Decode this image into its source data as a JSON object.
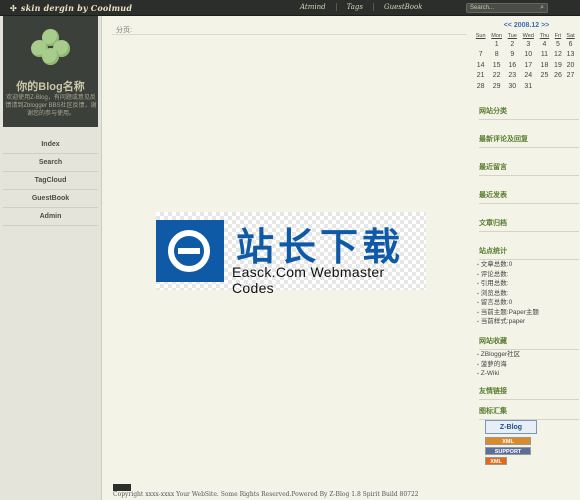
{
  "header": {
    "brand": "skin dergin by Coolmud",
    "nav": [
      "Atmind",
      "Tags",
      "GuestBook"
    ],
    "search_placeholder": "Search..."
  },
  "sidebar": {
    "site_title": "你的Blog名称",
    "site_desc": "欢迎使用Z-Blog，有问题或意见反馈请到Zblogger BBS社区反馈，谢谢您的参与使用。",
    "nav": [
      "Index",
      "Search",
      "TagCloud",
      "GuestBook",
      "Admin"
    ]
  },
  "main": {
    "breadcrumb": "分页:",
    "watermark_big": "站长下载",
    "watermark_small": "Easck.Com Webmaster Codes",
    "copyright": "Copyright xxxx-xxxx Your WebSite. Some Rights Reserved.Powered By Z-Blog 1.8 Spirit Build 80722"
  },
  "calendar": {
    "title": "<< 2008.12 >>",
    "weekdays": [
      "Sun",
      "Mon",
      "Tue",
      "Wed",
      "Thu",
      "Fri",
      "Sat"
    ],
    "rows": [
      [
        "",
        "1",
        "2",
        "3",
        "4",
        "5",
        "6"
      ],
      [
        "7",
        "8",
        "9",
        "10",
        "11",
        "12",
        "13"
      ],
      [
        "14",
        "15",
        "16",
        "17",
        "18",
        "19",
        "20"
      ],
      [
        "21",
        "22",
        "23",
        "24",
        "25",
        "26",
        "27"
      ],
      [
        "28",
        "29",
        "30",
        "31",
        "",
        "",
        ""
      ]
    ]
  },
  "right": {
    "sections": {
      "categories": "网站分类",
      "comments": "最新评论及回复",
      "guestbook": "最近留言",
      "posts": "最近发表",
      "archives": "文章归档",
      "stats": "站点统计",
      "favorites": "网站收藏",
      "links": "友情链接",
      "badges": "图标汇集"
    },
    "stats": [
      "文章总数:0",
      "评论总数:",
      "引用总数:",
      "浏览总数:",
      "留言总数:0",
      "当前主题:Paper主题",
      "当前样式:paper"
    ],
    "favorites": [
      "ZBlogger社区",
      "菠萝的海",
      "Z-Wiki"
    ],
    "badge_labels": [
      "Z-Blog",
      "XML",
      "SUPPORT",
      "XML"
    ],
    "colors": {
      "accent_green": "#5a7d2f",
      "calendar_blue": "#3b6fb0",
      "logo_bg": "#3c403a",
      "brand_blue": "#0f5aa6"
    }
  }
}
